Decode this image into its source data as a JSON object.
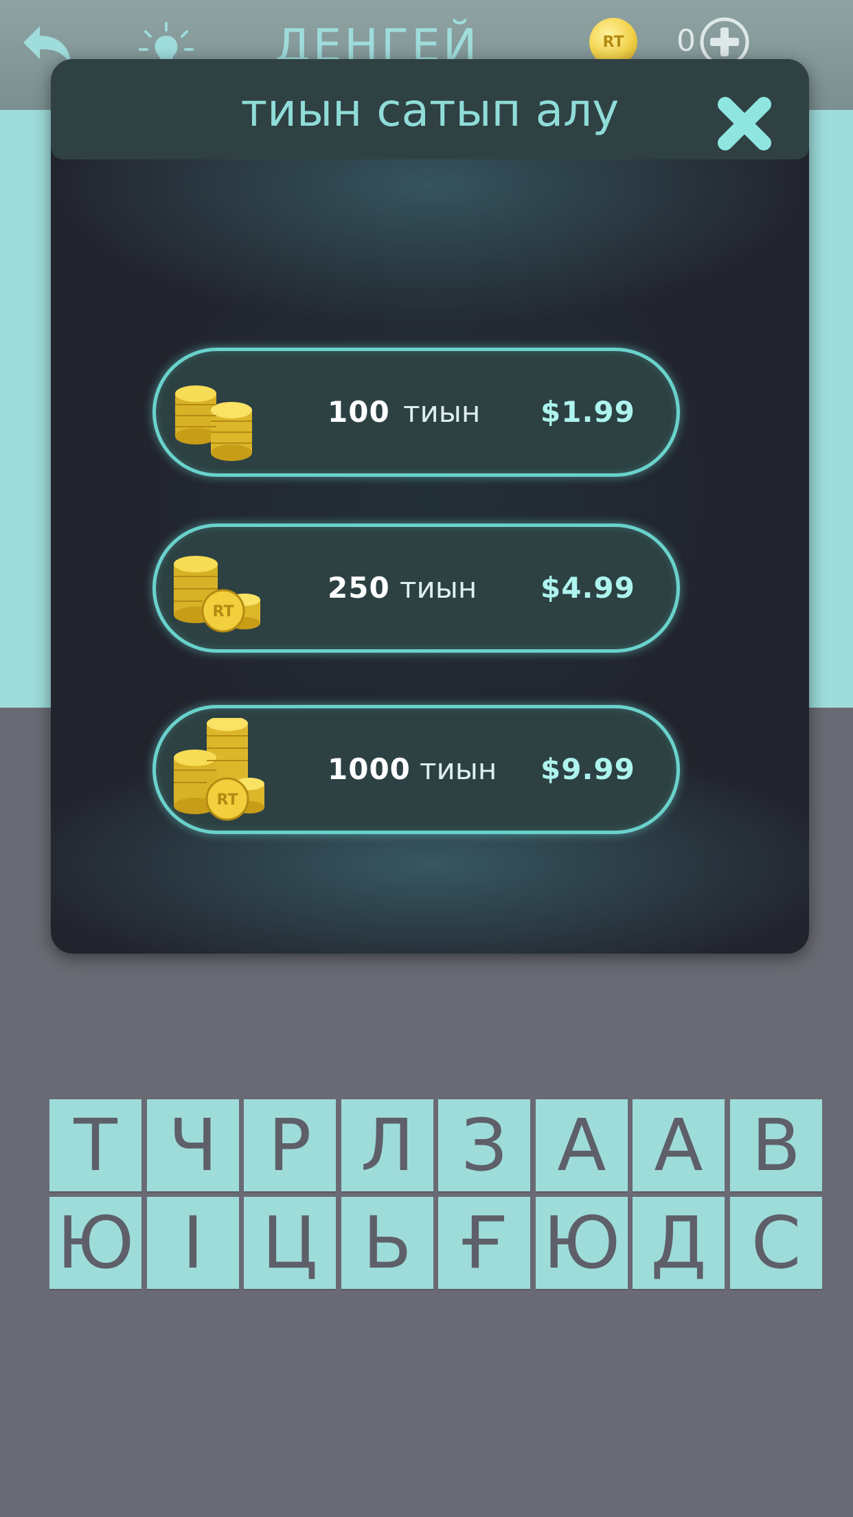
{
  "header": {
    "title": "ДЕНГЕЙ",
    "coin_label": "RT",
    "coin_count": "0"
  },
  "modal": {
    "title": "тиын сатып алу",
    "offers": [
      {
        "amount": "100",
        "unit": "тиын",
        "price": "$1.99"
      },
      {
        "amount": "250",
        "unit": "тиын",
        "price": "$4.99"
      },
      {
        "amount": "1000",
        "unit": "тиын",
        "price": "$9.99"
      }
    ]
  },
  "keyboard": {
    "row1": [
      "Т",
      "Ч",
      "Р",
      "Л",
      "З",
      "А",
      "А",
      "В"
    ],
    "row2": [
      "Ю",
      "І",
      "Ц",
      "Ь",
      "Ғ",
      "Ю",
      "Д",
      "С"
    ]
  },
  "colors": {
    "accent": "#9edcda",
    "modal_bg": "#22242d",
    "price": "#aef4ee",
    "key_text": "#5e5f69",
    "background": "#6a6a74"
  },
  "icons": [
    "back-arrow-icon",
    "lightbulb-icon",
    "coin-icon",
    "plus-icon",
    "close-icon",
    "coin-stack-icon"
  ]
}
